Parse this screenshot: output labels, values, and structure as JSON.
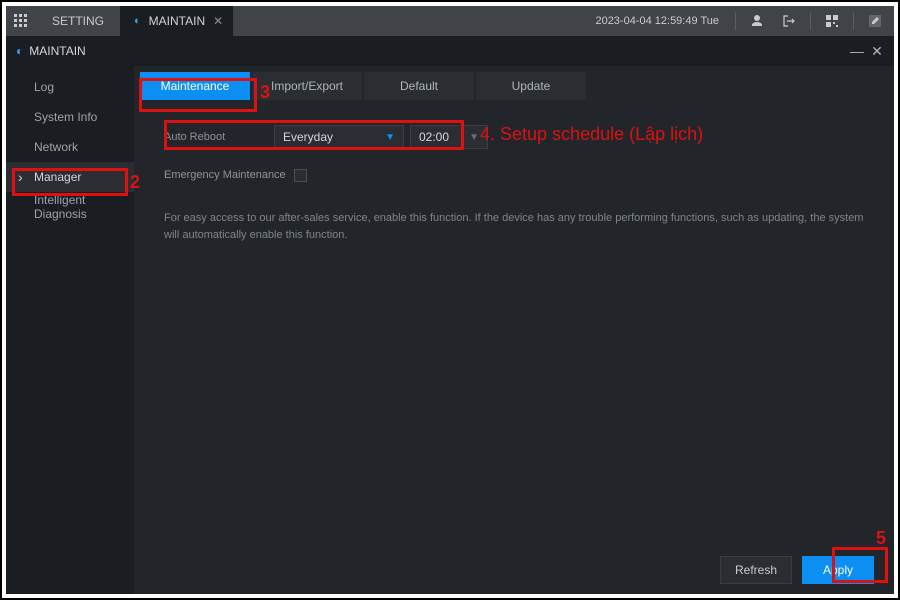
{
  "topbar": {
    "setting_label": "SETTING",
    "tab_label": "MAINTAIN",
    "datetime": "2023-04-04 12:59:49 Tue"
  },
  "header": {
    "title": "MAINTAIN"
  },
  "sidebar": {
    "items": [
      {
        "label": "Log"
      },
      {
        "label": "System Info"
      },
      {
        "label": "Network"
      },
      {
        "label": "Manager"
      },
      {
        "label": "Intelligent Diagnosis"
      }
    ]
  },
  "tabs": [
    {
      "label": "Maintenance"
    },
    {
      "label": "Import/Export"
    },
    {
      "label": "Default"
    },
    {
      "label": "Update"
    }
  ],
  "form": {
    "auto_reboot_label": "Auto Reboot",
    "day_value": "Everyday",
    "time_value": "02:00",
    "emergency_label": "Emergency Maintenance",
    "description": "For easy access to our after-sales service, enable this function. If the device has any trouble performing functions, such as updating, the system will automatically enable this function."
  },
  "footer": {
    "refresh": "Refresh",
    "apply": "Apply"
  },
  "annotations": {
    "n2": "2",
    "n3": "3",
    "n5": "5",
    "text4": "4. Setup schedule (Lập lịch)"
  }
}
